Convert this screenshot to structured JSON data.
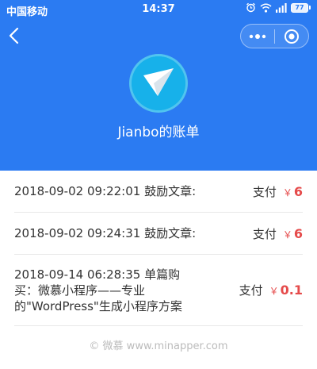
{
  "status_bar": {
    "carrier": "中国移动",
    "time": "14:37",
    "battery": "77"
  },
  "nav": {
    "back_icon": "chevron-left-icon",
    "menu_icon": "more-dots-icon",
    "close_icon": "target-circle-icon"
  },
  "header": {
    "avatar_icon": "paper-plane-icon",
    "title": "Jianbo的账单"
  },
  "transactions": [
    {
      "description": "2018-09-02 09:22:01 鼓励文章:",
      "pay_label": "支付",
      "currency": "￥",
      "amount": "6"
    },
    {
      "description": "2018-09-02 09:24:31 鼓励文章:",
      "pay_label": "支付",
      "currency": "￥",
      "amount": "6"
    },
    {
      "description": "2018-09-14 06:28:35 单篇购买：微慕小程序——专业的\"WordPress\"生成小程序方案",
      "pay_label": "支付",
      "currency": "￥",
      "amount": "0.1"
    }
  ],
  "footer": {
    "text": "© 微慕 www.minapper.com"
  },
  "colors": {
    "header_bg": "#2b7bf2",
    "amount": "#e54b4b",
    "footer": "#bbbbbb"
  }
}
